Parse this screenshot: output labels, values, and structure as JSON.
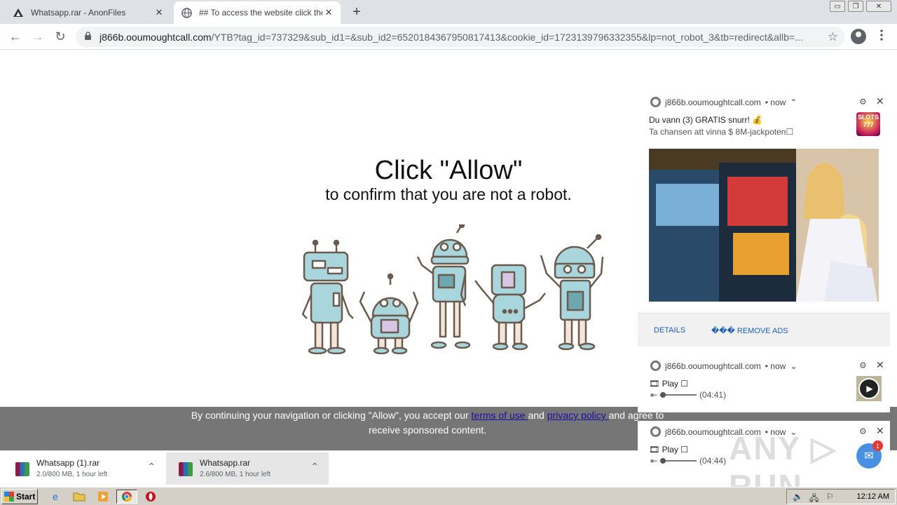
{
  "tabs": [
    {
      "title": "Whatsapp.rar - AnonFiles",
      "close": "✕",
      "favicon": "anonfiles-icon"
    },
    {
      "title": "## To access the website click the \"Allow\"",
      "close": "✕",
      "favicon": "globe-icon"
    }
  ],
  "new_tab": "+",
  "window_controls": {
    "minimize": "▭",
    "restore": "❐",
    "close": "✕"
  },
  "toolbar": {
    "back": "←",
    "forward": "→",
    "reload": "↻",
    "lock": "🔒",
    "url_host": "j866b.ooumoughtcall.com",
    "url_path": "/YTB?tag_id=737329&sub_id1=&sub_id2=6520184367950817413&cookie_id=1723139796332355&lp=not_robot_3&tb=redirect&allb=...",
    "star": "☆",
    "menu": "⋮"
  },
  "page": {
    "headline": "Click \"Allow\"",
    "subline": "to confirm that you are not a robot.",
    "consent_prefix": "By continuing your navigation or clicking \"Allow\", you accept our ",
    "terms_link": "terms of use ",
    "consent_and": "and ",
    "privacy_link": "privacy policy ",
    "consent_suffix": "and agree to receive sponsored content."
  },
  "notifications": [
    {
      "site": "j866b.ooumoughtcall.com",
      "time": "• now",
      "chevron": "⌃",
      "title": "Du vann (3) GRATIS snurr! 💰",
      "body": "Ta chansen att vinna $ 8M-jackpoten☐",
      "icon_text": "SLOTS 777",
      "details": "DETAILS",
      "remove_ads": "��� REMOVE ADS"
    },
    {
      "site": "j866b.ooumoughtcall.com",
      "time": "• now",
      "chevron": "⌄",
      "title": "🎞 Play ☐",
      "progress": "(04:41)"
    },
    {
      "site": "j866b.ooumoughtcall.com",
      "time": "• now",
      "chevron": "⌄",
      "title": "🎞 Play ☐",
      "progress": "(04:44)"
    }
  ],
  "gear": "⚙",
  "close": "✕",
  "watermark": "ANY ▷ RUN",
  "mail_count": "1",
  "downloads": [
    {
      "name": "Whatsapp (1).rar",
      "status": "2.0/800 MB, 1 hour left",
      "chevron": "⌃"
    },
    {
      "name": "Whatsapp.rar",
      "status": "2.6/800 MB, 1 hour left",
      "chevron": "⌃"
    }
  ],
  "taskbar": {
    "start": "Start",
    "clock": "12:12 AM",
    "icons": [
      "ie-icon",
      "folder-icon",
      "media-player-icon",
      "chrome-icon",
      "opera-icon"
    ]
  },
  "colors": {
    "consent_bg": "#767676",
    "link": "#1a0dab",
    "robot_fill": "#a9d6dc",
    "accent": "#1a5fb4"
  }
}
